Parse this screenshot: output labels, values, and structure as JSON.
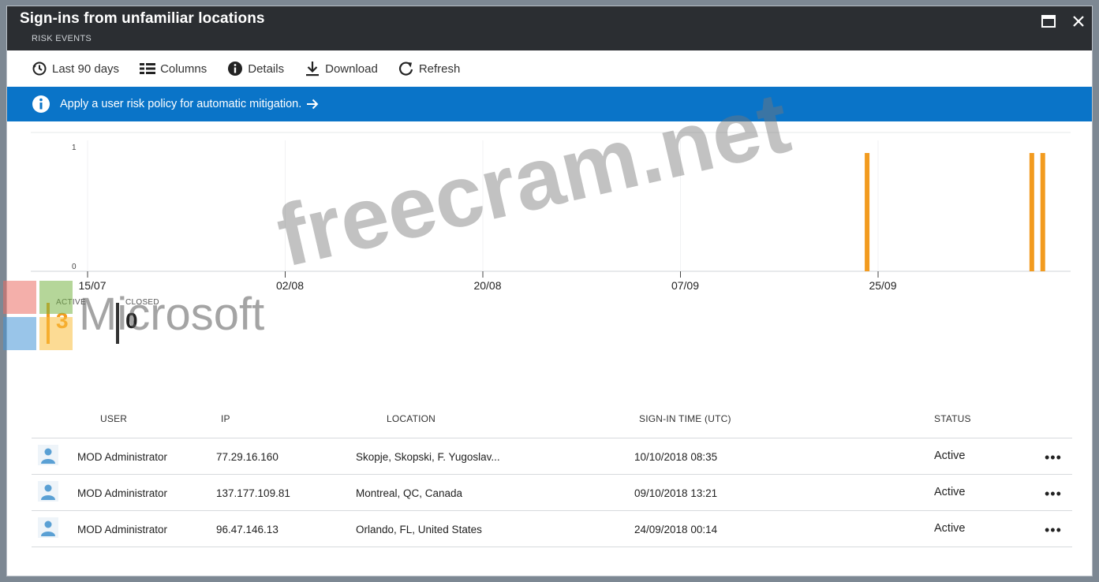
{
  "window": {
    "title": "Sign-ins from unfamiliar locations",
    "subtitle": "RISK EVENTS"
  },
  "toolbar": [
    {
      "label": "Last 90 days",
      "icon": "history-icon"
    },
    {
      "label": "Columns",
      "icon": "columns-icon"
    },
    {
      "label": "Details",
      "icon": "info-icon"
    },
    {
      "label": "Download",
      "icon": "download-icon"
    },
    {
      "label": "Refresh",
      "icon": "refresh-icon"
    }
  ],
  "banner": {
    "text": "Apply a user risk policy for automatic mitigation."
  },
  "chart_data": {
    "type": "bar",
    "y_ticks": [
      "1",
      "0"
    ],
    "ylim": [
      0,
      1
    ],
    "x_ticks": [
      "15/07",
      "02/08",
      "20/08",
      "07/09",
      "25/09"
    ],
    "x_tick_dates": [
      "2018-07-15",
      "2018-08-02",
      "2018-08-20",
      "2018-09-07",
      "2018-09-25"
    ],
    "x": [
      "2018-09-24",
      "2018-10-09",
      "2018-10-10"
    ],
    "values": [
      1,
      1,
      1
    ],
    "bar_color": "#f29b1f"
  },
  "summary": {
    "active_label": "ACTIVE",
    "active_value": "3",
    "closed_label": "CLOSED",
    "closed_value": "0",
    "active_color": "#f29b1f",
    "closed_color": "#333333"
  },
  "table": {
    "headers": [
      "USER",
      "IP",
      "LOCATION",
      "SIGN-IN TIME (UTC)",
      "STATUS"
    ],
    "rows": [
      {
        "user": "MOD Administrator",
        "ip": "77.29.16.160",
        "location": "Skopje, Skopski, F. Yugoslav...",
        "time": "10/10/2018 08:35",
        "status": "Active"
      },
      {
        "user": "MOD Administrator",
        "ip": "137.177.109.81",
        "location": "Montreal, QC, Canada",
        "time": "09/10/2018 13:21",
        "status": "Active"
      },
      {
        "user": "MOD Administrator",
        "ip": "96.47.146.13",
        "location": "Orlando, FL, United States",
        "time": "24/09/2018 00:14",
        "status": "Active"
      }
    ]
  },
  "watermark": {
    "text": "freecram.net",
    "brand": "Microsoft"
  }
}
